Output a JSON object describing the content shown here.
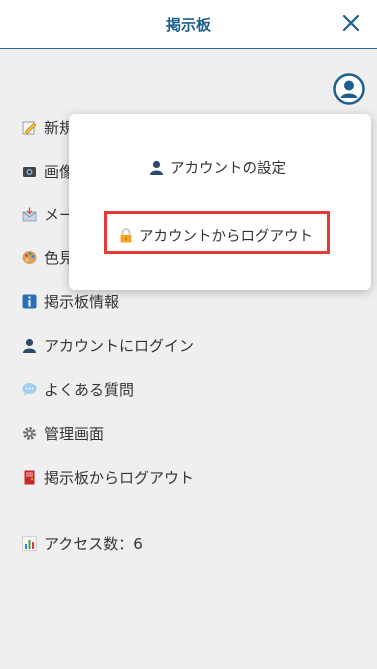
{
  "header": {
    "title": "掲示板"
  },
  "menu": {
    "items": [
      {
        "label": "新規スレッド作成",
        "icon": "memo-icon"
      },
      {
        "label": "画像アップロード",
        "icon": "camera-icon"
      },
      {
        "label": "メール設定",
        "icon": "mail-icon"
      },
      {
        "label": "色見本",
        "icon": "palette-icon"
      },
      {
        "label": "掲示板情報",
        "icon": "info-icon"
      },
      {
        "label": "アカウントにログイン",
        "icon": "user-icon"
      },
      {
        "label": "よくある質問",
        "icon": "speech-bubble-icon"
      },
      {
        "label": "管理画面",
        "icon": "gear-icon"
      },
      {
        "label": "掲示板からログアウト",
        "icon": "door-icon"
      }
    ],
    "access": {
      "label": "アクセス数：6",
      "icon": "bar-chart-icon"
    }
  },
  "popup": {
    "settings_label": "アカウントの設定",
    "logout_label": "アカウントからログアウト"
  },
  "colors": {
    "accent": "#1e5f8c",
    "highlight": "#e53935",
    "background": "#efefef"
  }
}
